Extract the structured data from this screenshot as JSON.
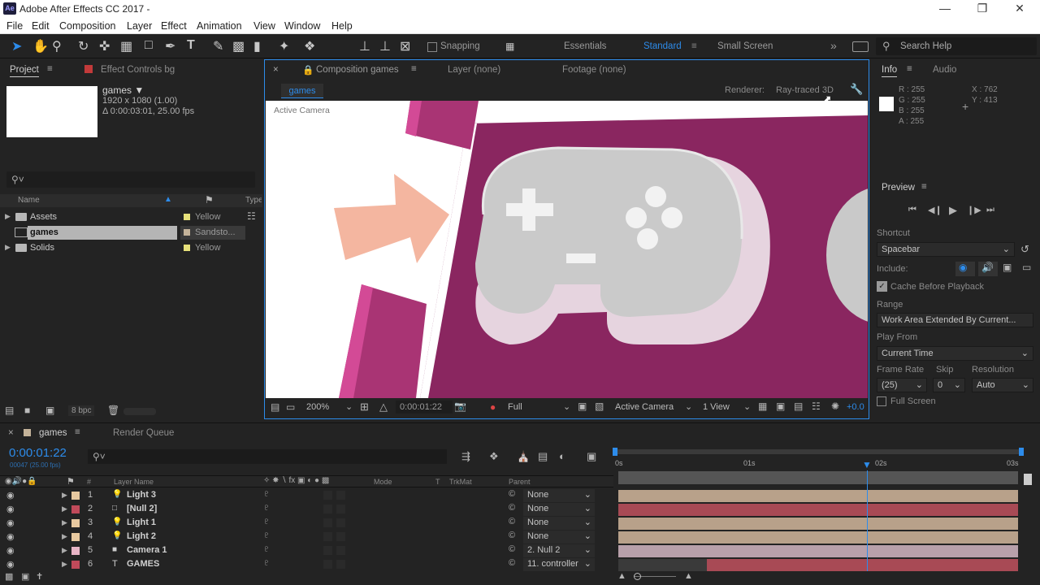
{
  "window": {
    "title": "Adobe After Effects CC 2017 -",
    "app_icon": "Ae"
  },
  "menu": [
    "File",
    "Edit",
    "Composition",
    "Layer",
    "Effect",
    "Animation",
    "View",
    "Window",
    "Help"
  ],
  "toolbar": {
    "snapping": "Snapping",
    "workspaces": [
      "Essentials",
      "Standard",
      "Small Screen"
    ],
    "search_placeholder": "Search Help"
  },
  "project": {
    "tabs": [
      "Project",
      "Effect Controls bg"
    ],
    "comp_name": "games ▼",
    "comp_size": "1920 x 1080 (1.00)",
    "comp_duration": "Δ 0:00:03:01, 25.00 fps",
    "columns": [
      "Name",
      "Type"
    ],
    "items": [
      {
        "name": "Assets",
        "label": "Yellow",
        "color": "#e6e07a"
      },
      {
        "name": "games",
        "label": "Sandsto...",
        "color": "#c4b39a"
      },
      {
        "name": "Solids",
        "label": "Yellow",
        "color": "#e6e07a"
      }
    ],
    "bpc": "8 bpc"
  },
  "composition": {
    "tabs": [
      "Composition games",
      "Layer (none)",
      "Footage (none)"
    ],
    "breadcrumb": "games",
    "renderer_label": "Renderer:",
    "renderer": "Ray-traced 3D",
    "camera_label": "Active Camera",
    "zoom": "200%",
    "timecode": "0:00:01:22",
    "resolution": "Full",
    "view_camera": "Active Camera",
    "views": "1 View",
    "exposure": "+0.0"
  },
  "info": {
    "tabs": [
      "Info",
      "Audio"
    ],
    "r": "R : 255",
    "g": "G : 255",
    "b": "B : 255",
    "a": "A : 255",
    "x": "X : 762",
    "y": "Y : 413"
  },
  "preview": {
    "title": "Preview",
    "shortcut_label": "Shortcut",
    "shortcut": "Spacebar",
    "include_label": "Include:",
    "cache_label": "Cache Before Playback",
    "range_label": "Range",
    "range": "Work Area Extended By Current...",
    "play_from_label": "Play From",
    "play_from": "Current Time",
    "frame_rate_label": "Frame Rate",
    "skip_label": "Skip",
    "resolution_label": "Resolution",
    "frame_rate": "(25)",
    "skip": "0",
    "resolution": "Auto",
    "full_screen": "Full Screen"
  },
  "timeline": {
    "tabs": [
      "games",
      "Render Queue"
    ],
    "timecode": "0:00:01:22",
    "frame_info": "00047 (25.00 fps)",
    "col_layer_name": "Layer Name",
    "col_mode": "Mode",
    "col_t": "T",
    "col_trkmat": "TrkMat",
    "col_parent": "Parent",
    "col_hash": "#",
    "ruler": [
      "0s",
      "01s",
      "02s",
      "03s"
    ],
    "layers": [
      {
        "num": "1",
        "name": "Light 3",
        "type": "light",
        "color": "#e8c9a0",
        "parent": "None",
        "bar": "#b8a18a"
      },
      {
        "num": "2",
        "name": "[Null 2]",
        "type": "null",
        "color": "#c04a5a",
        "parent": "None",
        "bar": "#a84a55"
      },
      {
        "num": "3",
        "name": "Light 1",
        "type": "light",
        "color": "#e8c9a0",
        "parent": "None",
        "bar": "#b8a18a"
      },
      {
        "num": "4",
        "name": "Light 2",
        "type": "light",
        "color": "#e8c9a0",
        "parent": "None",
        "bar": "#b8a18a"
      },
      {
        "num": "5",
        "name": "Camera 1",
        "type": "camera",
        "color": "#e8b5c6",
        "parent": "2. Null 2",
        "bar": "#b8a0aa"
      },
      {
        "num": "6",
        "name": "GAMES",
        "type": "text",
        "color": "#c04a5a",
        "parent": "11. controller",
        "bar": "#a84a55"
      }
    ]
  },
  "colors": {
    "accent": "#2d8ceb",
    "viewer_bg": "#ffffff",
    "magenta": "#8a2660",
    "controller": "#c9c9c9",
    "arrow": "#f4b6a0"
  }
}
